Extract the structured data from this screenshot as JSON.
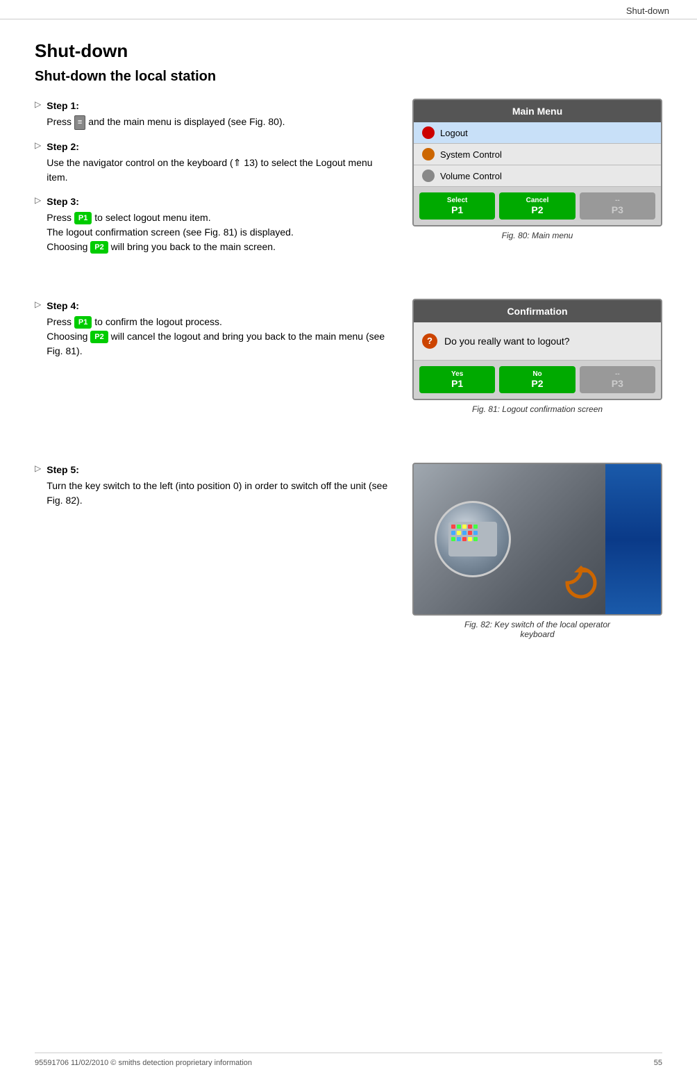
{
  "header": {
    "title": "Shut-down"
  },
  "page_title": "Shut-down",
  "section_title": "Shut-down the local station",
  "steps": [
    {
      "id": "step1",
      "label": "Step 1:",
      "text": "Press   and the main menu is displayed (see Fig. 80)."
    },
    {
      "id": "step2",
      "label": "Step 2:",
      "text": "Use the navigator control on the keyboard (⇑ 13) to select the Logout menu item."
    },
    {
      "id": "step3",
      "label": "Step 3:",
      "text_parts": [
        "Press  P1  to select logout menu item.",
        "The logout confirmation screen (see Fig. 81) is displayed.",
        "Choosing  P2  will bring you back to the main screen."
      ]
    },
    {
      "id": "step4",
      "label": "Step 4:",
      "text_parts": [
        "Press  P1  to confirm the logout process.",
        "Choosing  P2  will cancel the logout and bring you back to the main menu (see Fig. 81)."
      ]
    },
    {
      "id": "step5",
      "label": "Step 5:",
      "text": "Turn the key switch to the left (into position 0) in order to switch off the unit (see Fig. 82)."
    }
  ],
  "fig80": {
    "title": "Main Menu",
    "menu_items": [
      {
        "label": "Logout",
        "icon_color": "red"
      },
      {
        "label": "System Control",
        "icon_color": "orange"
      },
      {
        "label": "Volume Control",
        "icon_color": "gray"
      }
    ],
    "buttons": [
      {
        "key": "P1",
        "label": "Select",
        "style": "green"
      },
      {
        "key": "P2",
        "label": "Cancel",
        "style": "green"
      },
      {
        "key": "P3",
        "label": "--",
        "style": "gray"
      }
    ],
    "caption": "Fig. 80: Main menu"
  },
  "fig81": {
    "title": "Confirmation",
    "message": "Do you really want to logout?",
    "buttons": [
      {
        "key": "P1",
        "label": "Yes",
        "style": "green"
      },
      {
        "key": "P2",
        "label": "No",
        "style": "green"
      },
      {
        "key": "P3",
        "label": "--",
        "style": "gray"
      }
    ],
    "caption": "Fig. 81: Logout confirmation screen"
  },
  "fig82": {
    "caption_line1": "Fig. 82: Key switch of the local operator",
    "caption_line2": "keyboard"
  },
  "footer": {
    "left": "95591706 11/02/2010 © smiths detection proprietary information",
    "right": "55"
  }
}
